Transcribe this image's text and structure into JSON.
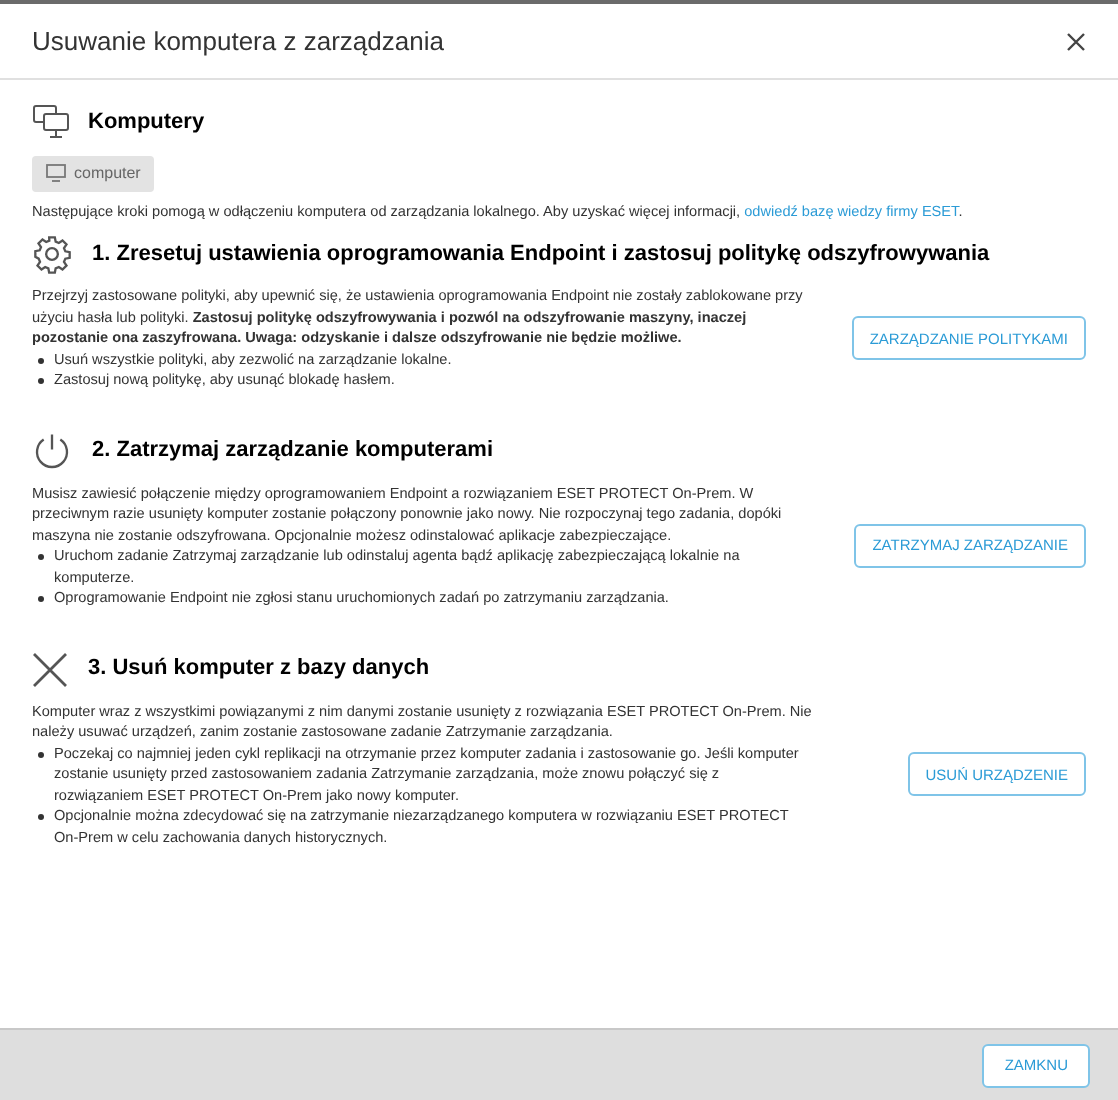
{
  "window": {
    "title": "Usuwanie komputera z zarządzania"
  },
  "computers": {
    "heading": "Komputery",
    "chip": "computer"
  },
  "intro": {
    "text": "Następujące kroki pomogą w odłączeniu komputera od zarządzania lokalnego. Aby uzyskać więcej informacji, ",
    "link": "odwiedź bazę wiedzy firmy ESET",
    "after": "."
  },
  "steps": [
    {
      "kind": "gear",
      "title": "1. Zresetuj ustawienia oprogramowania Endpoint i zastosuj politykę odszyfrowywania",
      "text": "Przejrzyj zastosowane polityki, aby upewnić się, że ustawienia oprogramowania Endpoint nie zostały zablokowane przy użyciu hasła lub polityki. **Zastosuj politykę odszyfrowywania i pozwól na odszyfrowanie maszyny, inaczej pozostanie ona zaszyfrowana. Uwaga: odzyskanie i dalsze odszyfrowanie nie będzie możliwe.**",
      "bullets": [
        "Usuń wszystkie polityki, aby zezwolić na zarządzanie lokalne.",
        "Zastosuj nową politykę, aby usunąć blokadę hasłem."
      ],
      "button": "ZARZĄDZANIE POLITYKAMI"
    },
    {
      "kind": "power",
      "title": "2. Zatrzymaj zarządzanie komputerami",
      "text": "Musisz zawiesić połączenie między oprogramowaniem Endpoint a rozwiązaniem ESET PROTECT On-Prem. W przeciwnym razie usunięty komputer zostanie połączony ponownie jako nowy. Nie rozpoczynaj tego zadania, dopóki maszyna nie zostanie odszyfrowana. Opcjonalnie możesz odinstalować aplikacje zabezpieczające.",
      "bullets": [
        "Uruchom zadanie Zatrzymaj zarządzanie lub odinstaluj agenta bądź aplikację zabezpieczającą lokalnie na komputerze.",
        "Oprogramowanie Endpoint nie zgłosi stanu uruchomionych zadań po zatrzymaniu zarządzania."
      ],
      "button": "ZATRZYMAJ ZARZĄDZANIE"
    },
    {
      "kind": "cross",
      "title": "3. Usuń komputer z bazy danych",
      "text": "Komputer wraz z wszystkimi powiązanymi z nim danymi zostanie usunięty z rozwiązania ESET PROTECT On-Prem. Nie należy usuwać urządzeń, zanim zostanie zastosowane zadanie Zatrzymanie zarządzania.",
      "bullets": [
        "Poczekaj co najmniej jeden cykl replikacji na otrzymanie przez komputer zadania i zastosowanie go. Jeśli komputer zostanie usunięty przed zastosowaniem zadania Zatrzymanie zarządzania, może znowu połączyć się z rozwiązaniem ESET PROTECT On-Prem jako nowy komputer.",
        "Opcjonalnie można zdecydować się na zatrzymanie niezarządzanego komputera w rozwiązaniu ESET PROTECT On-Prem w celu zachowania danych historycznych."
      ],
      "button": "USUŃ URZĄDZENIE"
    }
  ],
  "footer": {
    "button": "ZAMKNU"
  }
}
